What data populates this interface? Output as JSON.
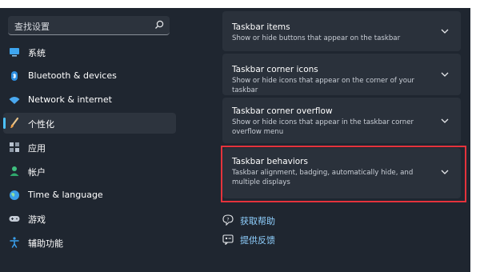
{
  "search": {
    "placeholder": "查找设置"
  },
  "sidebar": {
    "items": [
      {
        "label": "系统",
        "icon": "monitor-icon"
      },
      {
        "label": "Bluetooth & devices",
        "icon": "bluetooth-icon"
      },
      {
        "label": "Network & internet",
        "icon": "wifi-icon"
      },
      {
        "label": "个性化",
        "icon": "brush-icon",
        "selected": true
      },
      {
        "label": "应用",
        "icon": "apps-icon"
      },
      {
        "label": "帐户",
        "icon": "person-icon"
      },
      {
        "label": "Time & language",
        "icon": "globe-icon"
      },
      {
        "label": "游戏",
        "icon": "gamepad-icon"
      },
      {
        "label": "辅助功能",
        "icon": "accessibility-icon"
      }
    ]
  },
  "main": {
    "cards": [
      {
        "title": "Taskbar items",
        "description": "Show or hide buttons that appear on the taskbar"
      },
      {
        "title": "Taskbar corner icons",
        "description": "Show or hide icons that appear on the corner of your taskbar"
      },
      {
        "title": "Taskbar corner overflow",
        "description": "Show or hide icons that appear in the taskbar corner overflow menu"
      },
      {
        "title": "Taskbar behaviors",
        "description": "Taskbar alignment, badging, automatically hide, and multiple displays",
        "highlighted": true
      }
    ],
    "links": [
      {
        "label": "获取帮助",
        "icon": "help-icon"
      },
      {
        "label": "提供反馈",
        "icon": "feedback-icon"
      }
    ]
  },
  "colors": {
    "background": "#1f2630",
    "card": "#2a313b",
    "accent": "#4cc2ff",
    "highlight_border": "#e5333c",
    "link": "#8fd0ff"
  }
}
